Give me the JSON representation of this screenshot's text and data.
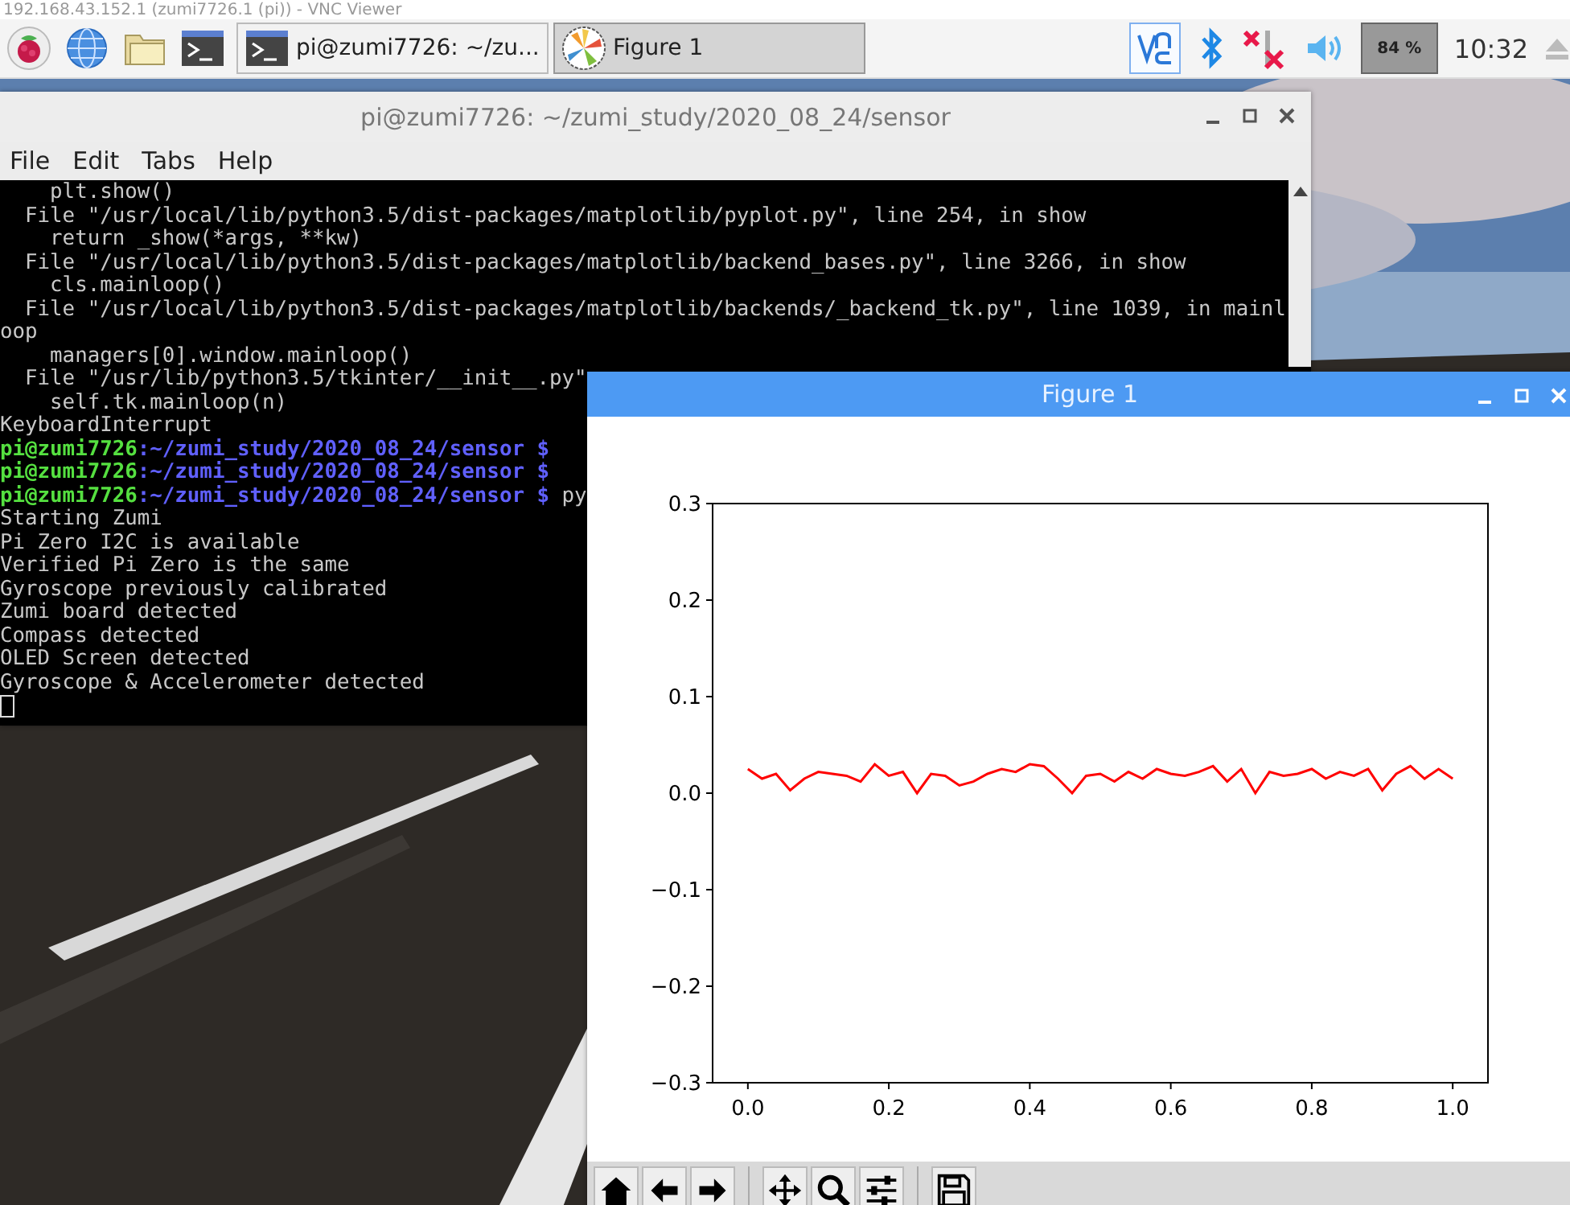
{
  "vnc_title": "192.168.43.152.1 (zumi7726.1 (pi)) - VNC Viewer",
  "taskbar": {
    "launchers": [
      {
        "kind": "raspberry"
      },
      {
        "kind": "globe"
      },
      {
        "kind": "folder"
      },
      {
        "kind": "terminal"
      }
    ],
    "tasks": [
      {
        "kind": "terminal",
        "label": "pi@zumi7726: ~/zu...",
        "selected": false
      },
      {
        "kind": "figure",
        "label": "Figure 1",
        "selected": true
      }
    ],
    "cpu": "84 %",
    "clock": "10:32"
  },
  "terminal": {
    "title": "pi@zumi7726: ~/zumi_study/2020_08_24/sensor",
    "active": false,
    "menu": [
      "File",
      "Edit",
      "Tabs",
      "Help"
    ],
    "lines": [
      {
        "kind": "output",
        "text": "    plt.show()"
      },
      {
        "kind": "output",
        "text": "  File \"/usr/local/lib/python3.5/dist-packages/matplotlib/pyplot.py\", line 254, in show"
      },
      {
        "kind": "output",
        "text": "    return _show(*args, **kw)"
      },
      {
        "kind": "output",
        "text": "  File \"/usr/local/lib/python3.5/dist-packages/matplotlib/backend_bases.py\", line 3266, in show"
      },
      {
        "kind": "output",
        "text": "    cls.mainloop()"
      },
      {
        "kind": "output",
        "text": "  File \"/usr/local/lib/python3.5/dist-packages/matplotlib/backends/_backend_tk.py\", line 1039, in mainl"
      },
      {
        "kind": "output",
        "text": "oop"
      },
      {
        "kind": "output",
        "text": "    managers[0].window.mainloop()"
      },
      {
        "kind": "output",
        "text": "  File \"/usr/lib/python3.5/tkinter/__init__.py\""
      },
      {
        "kind": "output",
        "text": "    self.tk.mainloop(n)"
      },
      {
        "kind": "output",
        "text": "KeyboardInterrupt"
      },
      {
        "kind": "prompt",
        "user": "pi@zumi7726",
        "path": ":~/zumi_study/2020_08_24/sensor $"
      },
      {
        "kind": "prompt",
        "user": "pi@zumi7726",
        "path": ":~/zumi_study/2020_08_24/sensor $"
      },
      {
        "kind": "prompt",
        "user": "pi@zumi7726",
        "path": ":~/zumi_study/2020_08_24/sensor $",
        "command": " py"
      },
      {
        "kind": "output",
        "text": "Starting Zumi"
      },
      {
        "kind": "output",
        "text": "Pi Zero I2C is available"
      },
      {
        "kind": "output",
        "text": "Verified Pi Zero is the same"
      },
      {
        "kind": "output",
        "text": "Gyroscope previously calibrated"
      },
      {
        "kind": "output",
        "text": "Zumi board detected"
      },
      {
        "kind": "output",
        "text": "Compass detected"
      },
      {
        "kind": "output",
        "text": "OLED Screen detected"
      },
      {
        "kind": "output",
        "text": "Gyroscope & Accelerometer detected"
      },
      {
        "kind": "cursor"
      }
    ]
  },
  "figure": {
    "title": "Figure 1",
    "active": true,
    "chart_data": {
      "type": "line",
      "x": [
        0,
        0.02,
        0.04,
        0.06,
        0.08,
        0.1,
        0.12,
        0.14,
        0.16,
        0.18,
        0.2,
        0.22,
        0.24,
        0.26,
        0.28,
        0.3,
        0.32,
        0.34,
        0.36,
        0.38,
        0.4,
        0.42,
        0.44,
        0.46,
        0.48,
        0.5,
        0.52,
        0.54,
        0.56,
        0.58,
        0.6,
        0.62,
        0.64,
        0.66,
        0.68,
        0.7,
        0.72,
        0.74,
        0.76,
        0.78,
        0.8,
        0.82,
        0.84,
        0.86,
        0.88,
        0.9,
        0.92,
        0.94,
        0.96,
        0.98,
        1.0
      ],
      "series": [
        {
          "color": "#ff0000",
          "values": [
            0.025,
            0.015,
            0.02,
            0.003,
            0.015,
            0.022,
            0.02,
            0.018,
            0.012,
            0.03,
            0.018,
            0.022,
            0.0,
            0.02,
            0.018,
            0.008,
            0.012,
            0.02,
            0.025,
            0.022,
            0.03,
            0.028,
            0.015,
            0.0,
            0.018,
            0.02,
            0.012,
            0.022,
            0.015,
            0.025,
            0.02,
            0.018,
            0.022,
            0.028,
            0.012,
            0.025,
            0.0,
            0.022,
            0.018,
            0.02,
            0.025,
            0.015,
            0.022,
            0.018,
            0.025,
            0.003,
            0.02,
            0.028,
            0.015,
            0.025,
            0.015
          ]
        }
      ],
      "xlim": [
        -0.05,
        1.05
      ],
      "ylim": [
        -0.3,
        0.3
      ],
      "xticks": [
        {
          "value": 0,
          "label": "0.0"
        },
        {
          "value": 0.2,
          "label": "0.2"
        },
        {
          "value": 0.4,
          "label": "0.4"
        },
        {
          "value": 0.6,
          "label": "0.6"
        },
        {
          "value": 0.8,
          "label": "0.8"
        },
        {
          "value": 1,
          "label": "1.0"
        }
      ],
      "yticks": [
        {
          "value": -0.3,
          "label": "−0.3"
        },
        {
          "value": -0.2,
          "label": "−0.2"
        },
        {
          "value": -0.1,
          "label": "−0.1"
        },
        {
          "value": 0,
          "label": "0.0"
        },
        {
          "value": 0.1,
          "label": "0.1"
        },
        {
          "value": 0.2,
          "label": "0.2"
        },
        {
          "value": 0.3,
          "label": "0.3"
        }
      ]
    },
    "toolbar": [
      {
        "kind": "home"
      },
      {
        "kind": "back"
      },
      {
        "kind": "forward"
      },
      {
        "kind": "sep"
      },
      {
        "kind": "pan"
      },
      {
        "kind": "zoom"
      },
      {
        "kind": "configure"
      },
      {
        "kind": "sep"
      },
      {
        "kind": "save"
      }
    ]
  }
}
